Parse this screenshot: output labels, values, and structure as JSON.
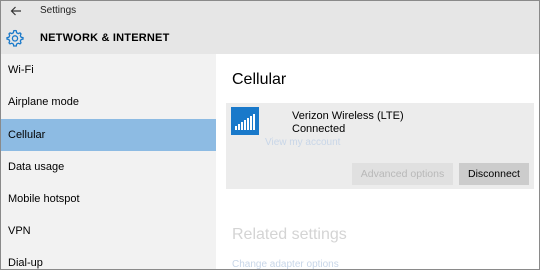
{
  "window": {
    "title": "Settings"
  },
  "header": {
    "title": "NETWORK & INTERNET"
  },
  "sidebar": {
    "items": [
      {
        "label": "Wi-Fi"
      },
      {
        "label": "Airplane mode"
      },
      {
        "label": "Cellular",
        "selected": true
      },
      {
        "label": "Data usage"
      },
      {
        "label": "Mobile hotspot"
      },
      {
        "label": "VPN"
      },
      {
        "label": "Dial-up"
      }
    ]
  },
  "main": {
    "title": "Cellular",
    "network": {
      "name": "Verizon Wireless (LTE)",
      "status": "Connected",
      "account_link": "View my account",
      "advanced_button": "Advanced options",
      "disconnect_button": "Disconnect"
    },
    "related": {
      "title": "Related settings",
      "link": "Change adapter options"
    }
  },
  "colors": {
    "accent": "#1979ca",
    "selection": "#8dbbe3",
    "header_bg": "#e6e6e6",
    "sidebar_bg": "#f2f2f2"
  },
  "icons": [
    "back-arrow-icon",
    "gear-icon",
    "cellular-signal-icon"
  ]
}
